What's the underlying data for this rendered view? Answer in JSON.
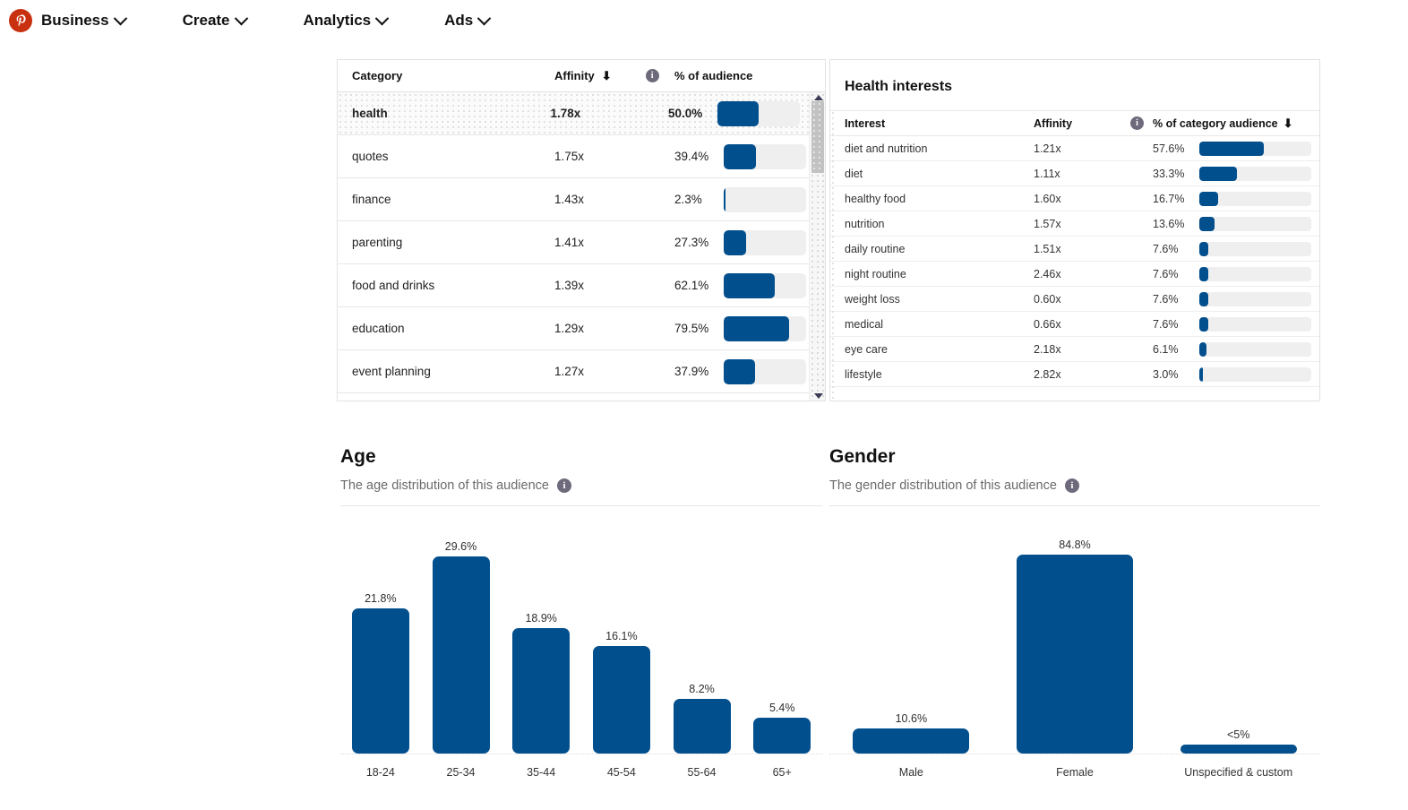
{
  "nav": {
    "logo_icon": "pinterest-logo-icon",
    "items": [
      {
        "label": "Business",
        "icon": "chevron-down-icon"
      },
      {
        "label": "Create",
        "icon": "chevron-down-icon"
      },
      {
        "label": "Analytics",
        "icon": "chevron-down-icon"
      },
      {
        "label": "Ads",
        "icon": "chevron-down-icon"
      }
    ]
  },
  "colors": {
    "bar_blue": "#024F8E",
    "track_grey": "#efefef",
    "brand_red": "#C8300F",
    "info_grey": "#6E6A7C"
  },
  "category_table": {
    "columns": {
      "category": "Category",
      "affinity": "Affinity",
      "affinity_sort_icon": "sort-descending-arrow-icon",
      "affinity_info_icon": "info-icon",
      "pct_of_audience": "% of audience"
    },
    "rows": [
      {
        "category": "health",
        "affinity": "1.78x",
        "pct": "50.0%",
        "pct_value": 50.0,
        "selected": true,
        "chevron_icon": "chevron-right-icon"
      },
      {
        "category": "quotes",
        "affinity": "1.75x",
        "pct": "39.4%",
        "pct_value": 39.4,
        "selected": false
      },
      {
        "category": "finance",
        "affinity": "1.43x",
        "pct": "2.3%",
        "pct_value": 2.3,
        "selected": false
      },
      {
        "category": "parenting",
        "affinity": "1.41x",
        "pct": "27.3%",
        "pct_value": 27.3,
        "selected": false
      },
      {
        "category": "food and drinks",
        "affinity": "1.39x",
        "pct": "62.1%",
        "pct_value": 62.1,
        "selected": false
      },
      {
        "category": "education",
        "affinity": "1.29x",
        "pct": "79.5%",
        "pct_value": 79.5,
        "selected": false
      },
      {
        "category": "event planning",
        "affinity": "1.27x",
        "pct": "37.9%",
        "pct_value": 37.9,
        "selected": false
      }
    ],
    "scrollbar": {
      "up_arrow_icon": "scroll-up-arrow-icon",
      "down_arrow_icon": "scroll-down-arrow-icon"
    }
  },
  "health_interests": {
    "title": "Health interests",
    "columns": {
      "interest": "Interest",
      "affinity": "Affinity",
      "affinity_info_icon": "info-icon",
      "pct_of_category_audience": "% of category audience",
      "pct_sort_icon": "sort-descending-arrow-icon"
    },
    "rows": [
      {
        "interest": "diet and nutrition",
        "affinity": "1.21x",
        "pct": "57.6%",
        "pct_value": 57.6
      },
      {
        "interest": "diet",
        "affinity": "1.11x",
        "pct": "33.3%",
        "pct_value": 33.3
      },
      {
        "interest": "healthy food",
        "affinity": "1.60x",
        "pct": "16.7%",
        "pct_value": 16.7
      },
      {
        "interest": "nutrition",
        "affinity": "1.57x",
        "pct": "13.6%",
        "pct_value": 13.6
      },
      {
        "interest": "daily routine",
        "affinity": "1.51x",
        "pct": "7.6%",
        "pct_value": 7.6
      },
      {
        "interest": "night routine",
        "affinity": "2.46x",
        "pct": "7.6%",
        "pct_value": 7.6
      },
      {
        "interest": "weight loss",
        "affinity": "0.60x",
        "pct": "7.6%",
        "pct_value": 7.6
      },
      {
        "interest": "medical",
        "affinity": "0.66x",
        "pct": "7.6%",
        "pct_value": 7.6
      },
      {
        "interest": "eye care",
        "affinity": "2.18x",
        "pct": "6.1%",
        "pct_value": 6.1
      },
      {
        "interest": "lifestyle",
        "affinity": "2.82x",
        "pct": "3.0%",
        "pct_value": 3.0
      }
    ]
  },
  "age_section": {
    "title": "Age",
    "subtitle": "The age distribution of this audience",
    "info_icon": "info-icon"
  },
  "gender_section": {
    "title": "Gender",
    "subtitle": "The gender distribution of this audience",
    "info_icon": "info-icon"
  },
  "chart_data": [
    {
      "type": "bar",
      "title": "Age",
      "subtitle": "The age distribution of this audience",
      "xlabel": "",
      "ylabel": "",
      "ylim": [
        0,
        29.6
      ],
      "grid": false,
      "legend": "none",
      "categories": [
        "18-24",
        "25-34",
        "35-44",
        "45-54",
        "55-64",
        "65+"
      ],
      "values": [
        21.8,
        29.6,
        18.9,
        16.1,
        8.2,
        5.4
      ],
      "data_labels": [
        "21.8%",
        "29.6%",
        "18.9%",
        "16.1%",
        "8.2%",
        "5.4%"
      ],
      "color": "#024F8E"
    },
    {
      "type": "bar",
      "title": "Gender",
      "subtitle": "The gender distribution of this audience",
      "xlabel": "",
      "ylabel": "",
      "ylim": [
        0,
        84.8
      ],
      "grid": false,
      "legend": "none",
      "categories": [
        "Male",
        "Female",
        "Unspecified & custom"
      ],
      "values": [
        10.6,
        84.8,
        2.0
      ],
      "data_labels": [
        "10.6%",
        "84.8%",
        "<5%"
      ],
      "color": "#024F8E"
    }
  ]
}
